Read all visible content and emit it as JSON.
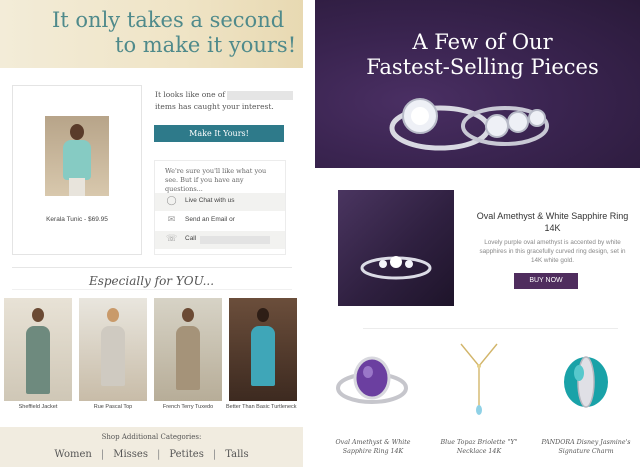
{
  "left_panel": {
    "header": {
      "line1": "It only takes a second",
      "line2": "to make it yours!"
    },
    "product": {
      "caption": "Kerala Tunic - $69.95"
    },
    "message": {
      "text_before": "It looks like one of",
      "text_after": "items has caught your interest."
    },
    "make_button": "Make It Yours!",
    "help": {
      "text": "We're sure you'll like what you see. But if you have any questions...",
      "live_chat": "Live Chat with us",
      "email": "Send an Email or",
      "call": "Call"
    },
    "especially": "Especially for YOU...",
    "tiles": [
      {
        "caption": "Sheffield Jacket"
      },
      {
        "caption": "Rue Pascal Top"
      },
      {
        "caption": "French Terry Tuxedo"
      },
      {
        "caption": "Better Than Basic Turtleneck"
      }
    ],
    "footer": {
      "heading": "Shop Additional Categories:",
      "categories": [
        "Women",
        "Misses",
        "Petites",
        "Talls"
      ]
    }
  },
  "right_panel": {
    "hero": {
      "line1": "A Few of Our",
      "line2": "Fastest-Selling Pieces"
    },
    "featured": {
      "title": "Oval Amethyst & White Sapphire Ring 14K",
      "description": "Lovely purple oval amethyst is accented by white sapphires in this gracefully curved ring design, set in 14K white gold.",
      "button": "BUY NOW"
    },
    "thumbnails": [
      {
        "caption": "Oval Amethyst & White Sapphire Ring 14K"
      },
      {
        "caption": "Blue Topaz Briolette \"Y\" Necklace 14K"
      },
      {
        "caption": "PANDORA Disney Jasmine's Signature Charm"
      }
    ],
    "colors": {
      "purple_button": "#4f2d5e",
      "teal_button": "#2e7a8a",
      "hero_bg": "#3a2450"
    }
  }
}
